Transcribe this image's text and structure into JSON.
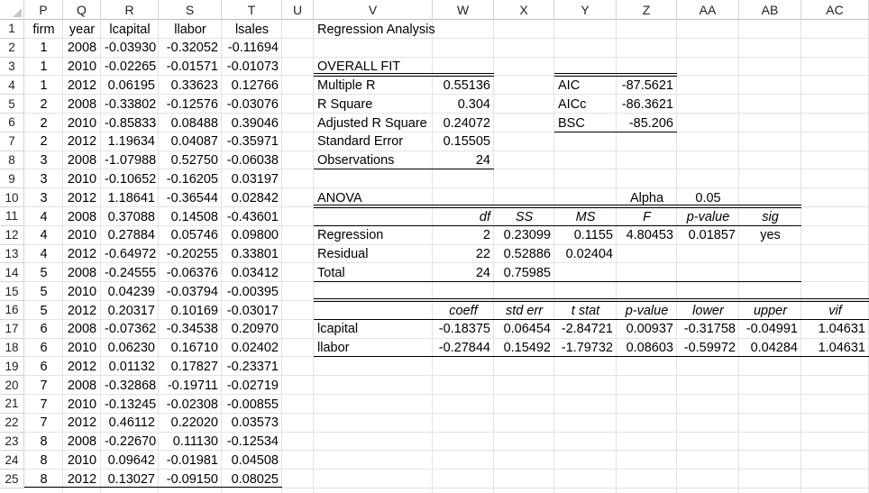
{
  "columns": [
    "P",
    "Q",
    "R",
    "S",
    "T",
    "U",
    "V",
    "W",
    "X",
    "Y",
    "Z",
    "AA",
    "AB",
    "AC"
  ],
  "rows": [
    "1",
    "2",
    "3",
    "4",
    "5",
    "6",
    "7",
    "8",
    "9",
    "10",
    "11",
    "12",
    "13",
    "14",
    "15",
    "16",
    "17",
    "18",
    "19",
    "20",
    "21",
    "22",
    "23",
    "24",
    "25"
  ],
  "data_table": {
    "headers": [
      "firm",
      "year",
      "lcapital",
      "llabor",
      "lsales"
    ],
    "rows": [
      [
        "1",
        "2008",
        "-0.03930",
        "-0.32052",
        "-0.11694"
      ],
      [
        "1",
        "2010",
        "-0.02265",
        "-0.01571",
        "-0.01073"
      ],
      [
        "1",
        "2012",
        "0.06195",
        "0.33623",
        "0.12766"
      ],
      [
        "2",
        "2008",
        "-0.33802",
        "-0.12576",
        "-0.03076"
      ],
      [
        "2",
        "2010",
        "-0.85833",
        "0.08488",
        "0.39046"
      ],
      [
        "2",
        "2012",
        "1.19634",
        "0.04087",
        "-0.35971"
      ],
      [
        "3",
        "2008",
        "-1.07988",
        "0.52750",
        "-0.06038"
      ],
      [
        "3",
        "2010",
        "-0.10652",
        "-0.16205",
        "0.03197"
      ],
      [
        "3",
        "2012",
        "1.18641",
        "-0.36544",
        "0.02842"
      ],
      [
        "4",
        "2008",
        "0.37088",
        "0.14508",
        "-0.43601"
      ],
      [
        "4",
        "2010",
        "0.27884",
        "0.05746",
        "0.09800"
      ],
      [
        "4",
        "2012",
        "-0.64972",
        "-0.20255",
        "0.33801"
      ],
      [
        "5",
        "2008",
        "-0.24555",
        "-0.06376",
        "0.03412"
      ],
      [
        "5",
        "2010",
        "0.04239",
        "-0.03794",
        "-0.00395"
      ],
      [
        "5",
        "2012",
        "0.20317",
        "0.10169",
        "-0.03017"
      ],
      [
        "6",
        "2008",
        "-0.07362",
        "-0.34538",
        "0.20970"
      ],
      [
        "6",
        "2010",
        "0.06230",
        "0.16710",
        "0.02402"
      ],
      [
        "6",
        "2012",
        "0.01132",
        "0.17827",
        "-0.23371"
      ],
      [
        "7",
        "2008",
        "-0.32868",
        "-0.19711",
        "-0.02719"
      ],
      [
        "7",
        "2010",
        "-0.13245",
        "-0.02308",
        "-0.00855"
      ],
      [
        "7",
        "2012",
        "0.46112",
        "0.22020",
        "0.03573"
      ],
      [
        "8",
        "2008",
        "-0.22670",
        "0.11130",
        "-0.12534"
      ],
      [
        "8",
        "2010",
        "0.09642",
        "-0.01981",
        "0.04508"
      ],
      [
        "8",
        "2012",
        "0.13027",
        "-0.09150",
        "0.08025"
      ]
    ]
  },
  "regression": {
    "title": "Regression Analysis",
    "overall_fit_label": "OVERALL FIT",
    "fit_stats": [
      {
        "label": "Multiple R",
        "value": "0.55136"
      },
      {
        "label": "R Square",
        "value": "0.304"
      },
      {
        "label": "Adjusted R Square",
        "value": "0.24072"
      },
      {
        "label": "Standard Error",
        "value": "0.15505"
      },
      {
        "label": "Observations",
        "value": "24"
      }
    ],
    "info_criteria": [
      {
        "label": "AIC",
        "value": "-87.5621"
      },
      {
        "label": "AICc",
        "value": "-86.3621"
      },
      {
        "label": "BSC",
        "value": "-85.206"
      }
    ],
    "anova_label": "ANOVA",
    "alpha_label": "Alpha",
    "alpha_value": "0.05",
    "anova_headers": [
      "df",
      "SS",
      "MS",
      "F",
      "p-value",
      "sig"
    ],
    "anova_rows": [
      {
        "label": "Regression",
        "df": "2",
        "ss": "0.23099",
        "ms": "0.1155",
        "f": "4.80453",
        "p": "0.01857",
        "sig": "yes"
      },
      {
        "label": "Residual",
        "df": "22",
        "ss": "0.52886",
        "ms": "0.02404",
        "f": "",
        "p": "",
        "sig": ""
      },
      {
        "label": "Total",
        "df": "24",
        "ss": "0.75985",
        "ms": "",
        "f": "",
        "p": "",
        "sig": ""
      }
    ],
    "coef_headers": [
      "coeff",
      "std err",
      "t stat",
      "p-value",
      "lower",
      "upper",
      "vif"
    ],
    "coef_rows": [
      {
        "label": "lcapital",
        "vals": [
          "-0.18375",
          "0.06454",
          "-2.84721",
          "0.00937",
          "-0.31758",
          "-0.04991",
          "1.04631"
        ]
      },
      {
        "label": "llabor",
        "vals": [
          "-0.27844",
          "0.15492",
          "-1.79732",
          "0.08603",
          "-0.59972",
          "0.04284",
          "1.04631"
        ]
      }
    ]
  }
}
